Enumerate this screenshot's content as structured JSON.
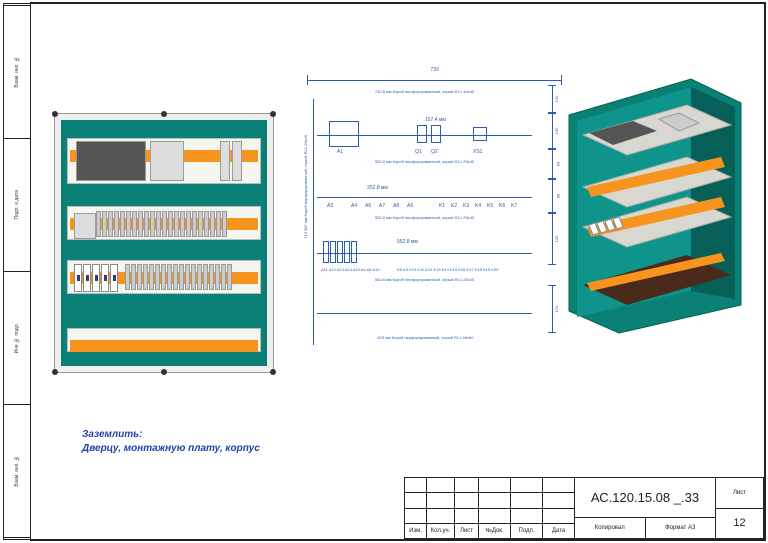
{
  "leftstrip": [
    "Взам. инв. №",
    "Подп. и дата",
    "Инв.№ подл.",
    "Взам. инв. №"
  ],
  "note_line1": "Заземлить:",
  "note_line2": "Дверцу, монтажную плату, корпус",
  "dim_width": "733",
  "duct_labels": {
    "top": "742.8 мм  Короб перфорированный, серый RL1 40x40",
    "mid1": "552.8 мм  Короб перфорированный, серый RL1 25x40",
    "mid2": "552.8 мм  Короб перфорированный, серый RL1 25x40",
    "mid3": "552.8 мм  Короб перфорированный, серый RL1 25x40",
    "bot": "823 мм  Короб перфорированный, серый RL1 40x60"
  },
  "side_duct": "714 587 мм  Короб перфорированный, серый RL1 25x40",
  "row_devs": {
    "r1": [
      "A1",
      "",
      "Q1",
      "Q2",
      "",
      "XS1"
    ],
    "r1_dim": "157.4 мм",
    "r2": [
      "A3",
      "",
      "A4",
      "A6",
      "A7",
      "A8",
      "A9"
    ],
    "r2_dim": "252.8 мм",
    "r2_right": [
      "K1",
      "K2",
      "K3",
      "K4",
      "K5",
      "K6",
      "K7"
    ],
    "r3_left": [
      "A11",
      "A12",
      "A13",
      "A14",
      "A15",
      "A4",
      "A5",
      "A10"
    ],
    "r3_right": [
      "K8",
      "K9",
      "K10",
      "K11",
      "K12",
      "K13",
      "K14",
      "K15",
      "K16",
      "K17",
      "K18",
      "K19",
      "K20"
    ],
    "r3_dim": "552.8 мм"
  },
  "right_dims": [
    "120",
    "100",
    "84",
    "88",
    "120",
    "120"
  ],
  "titleblock": {
    "headers": [
      "Изм.",
      "Кол.уч.",
      "Лист",
      "№Док.",
      "Подп.",
      "Дата"
    ],
    "drawing_no": "АС.120.15.08 _.33",
    "copied": "Копировал",
    "sheet_hdr": "Лист",
    "sheet_no": "12",
    "format": "Формат   A3"
  }
}
